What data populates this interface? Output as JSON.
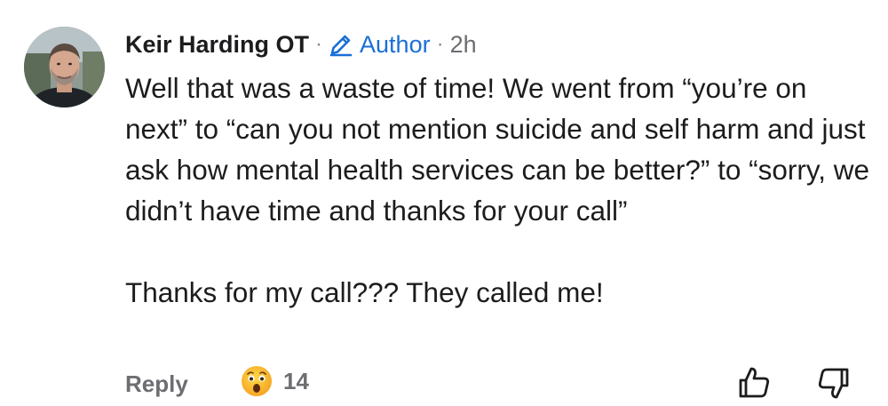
{
  "comment": {
    "author": {
      "name": "Keir Harding OT",
      "badge_label": "Author",
      "badge_icon": "pencil-icon",
      "timestamp": "2h",
      "accent_color": "#1a6fd6"
    },
    "text_paragraph_1": "Well that was a waste of time!  We went from “you’re on next” to “can you not mention suicide and self harm and just ask how mental health services can be better?” to “sorry, we didn’t have time and thanks for your call”",
    "text_paragraph_2": "Thanks for my call??? They called me!",
    "actions": {
      "reply_label": "Reply",
      "reaction_icon": "astonished-face-emoji",
      "reaction_count": "14",
      "upvote_icon": "thumbs-up-icon",
      "downvote_icon": "thumbs-down-icon"
    }
  },
  "separator": "·"
}
